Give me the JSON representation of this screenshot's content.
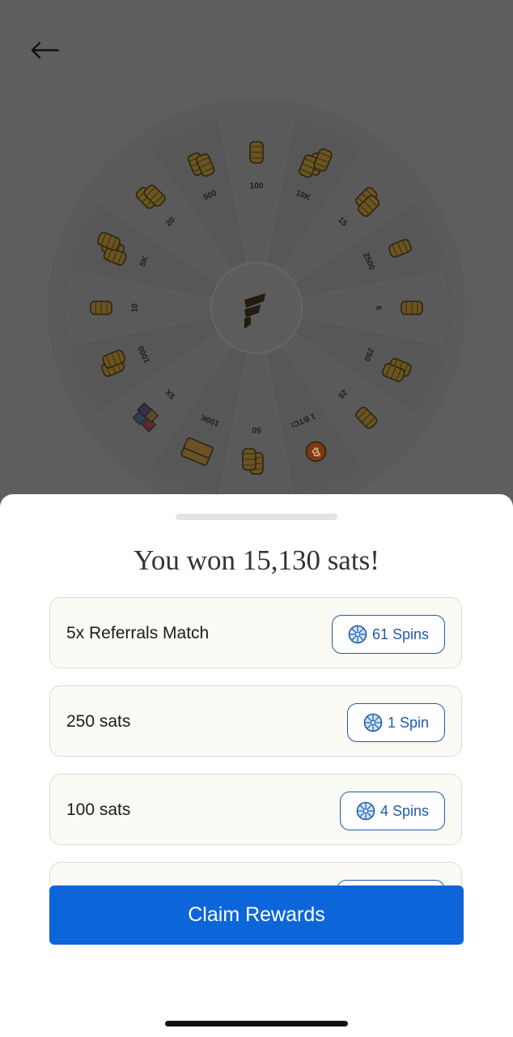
{
  "screen": {
    "back_icon": "arrow-left-icon",
    "overlay_color": "#5e5e5e"
  },
  "wheel": {
    "center_icon": "fold-logo-icon",
    "segments": [
      {
        "label": "500",
        "prize_icon": "sats-coins-icon"
      },
      {
        "label": "100",
        "prize_icon": "sats-coins-icon"
      },
      {
        "label": "10K",
        "prize_icon": "sats-coins-icon"
      },
      {
        "label": "15",
        "prize_icon": "sats-coins-icon"
      },
      {
        "label": "2500",
        "prize_icon": "sats-coins-icon"
      },
      {
        "label": "5",
        "prize_icon": "sats-coins-icon"
      },
      {
        "label": "250",
        "prize_icon": "sats-coins-icon"
      },
      {
        "label": "25",
        "prize_icon": "sats-coins-icon"
      },
      {
        "label": "1 BTC!",
        "prize_icon": "bitcoin-coin-icon"
      },
      {
        "label": "50",
        "prize_icon": "sats-coins-icon"
      },
      {
        "label": "100K",
        "prize_icon": "treasure-chest-icon"
      },
      {
        "label": "5X",
        "prize_icon": "gift-pile-icon"
      },
      {
        "label": "1000",
        "prize_icon": "sats-coins-icon"
      },
      {
        "label": "10",
        "prize_icon": "sats-coins-icon"
      },
      {
        "label": "5K",
        "prize_icon": "sats-coins-icon"
      },
      {
        "label": "20",
        "prize_icon": "sats-coins-icon"
      }
    ]
  },
  "sheet": {
    "title": "You won 15,130 sats!",
    "rewards": [
      {
        "label": "5x Referrals Match",
        "spins": "61 Spins"
      },
      {
        "label": "250 sats",
        "spins": "1 Spin"
      },
      {
        "label": "100 sats",
        "spins": "4 Spins"
      },
      {
        "label": "",
        "spins": ""
      }
    ],
    "spin_icon": "spin-wheel-icon",
    "claim_label": "Claim Rewards"
  },
  "colors": {
    "accent": "#0d66d9",
    "pill_text": "#1f5ca8",
    "card_bg": "#fbfaf4"
  }
}
